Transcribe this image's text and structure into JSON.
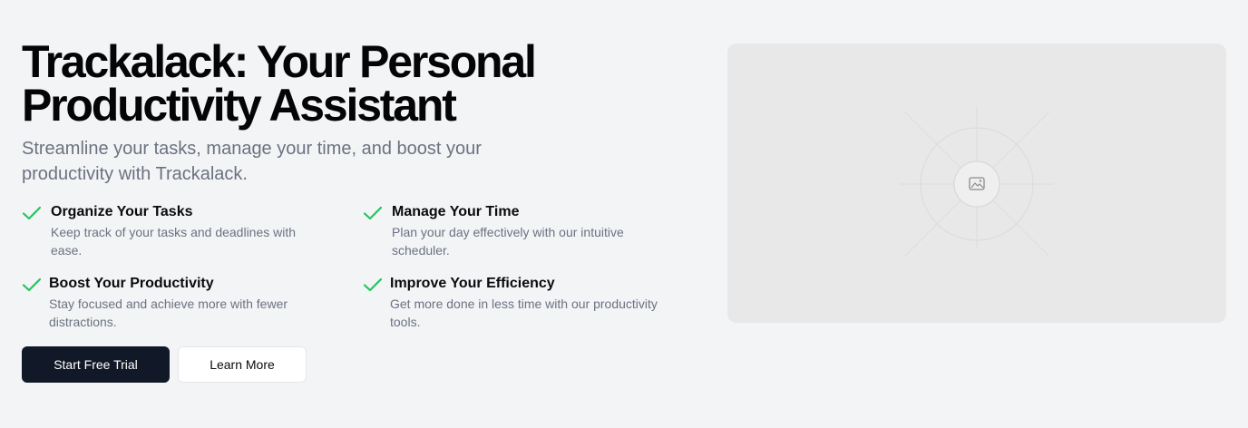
{
  "hero": {
    "title": "Trackalack: Your Personal Productivity Assistant",
    "subtitle": "Streamline your tasks, manage your time, and boost your productivity with Trackalack."
  },
  "features": [
    {
      "title": "Organize Your Tasks",
      "description": "Keep track of your tasks and deadlines with ease.",
      "icon": "check-icon"
    },
    {
      "title": "Manage Your Time",
      "description": "Plan your day effectively with our intuitive scheduler.",
      "icon": "check-icon"
    },
    {
      "title": "Boost Your Productivity",
      "description": "Stay focused and achieve more with fewer distractions.",
      "icon": "check-icon"
    },
    {
      "title": "Improve Your Efficiency",
      "description": "Get more done in less time with our productivity tools.",
      "icon": "check-icon"
    }
  ],
  "actions": {
    "primary_label": "Start Free Trial",
    "secondary_label": "Learn More"
  },
  "image": {
    "icon": "image-placeholder-icon"
  },
  "colors": {
    "background": "#f3f4f6",
    "check": "#22c55e",
    "primary_button": "#111827",
    "muted_text": "#6b7280",
    "placeholder": "#e8e8e8"
  }
}
